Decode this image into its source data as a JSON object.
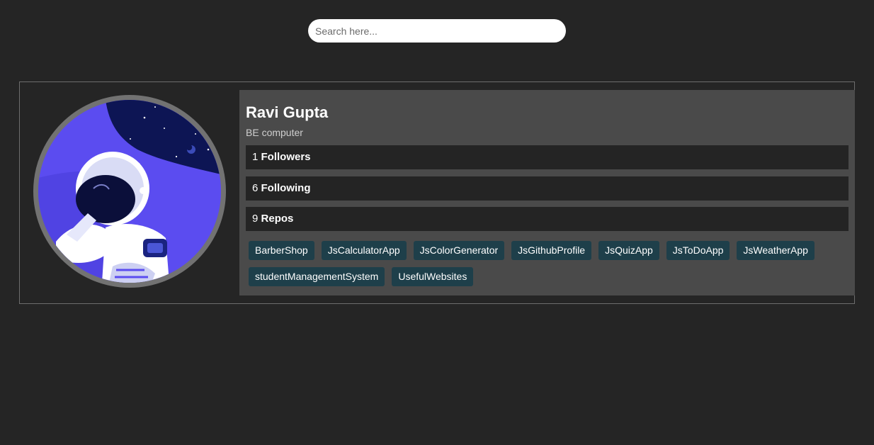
{
  "search": {
    "placeholder": "Search here..."
  },
  "profile": {
    "name": "Ravi Gupta",
    "bio": "BE computer",
    "avatar_icon": "astronaut-avatar",
    "stats": {
      "followers": {
        "count": "1",
        "label": "Followers"
      },
      "following": {
        "count": "6",
        "label": "Following"
      },
      "repos": {
        "count": "9",
        "label": "Repos"
      }
    },
    "repos": [
      "BarberShop",
      "JsCalculatorApp",
      "JsColorGenerator",
      "JsGithubProfile",
      "JsQuizApp",
      "JsToDoApp",
      "JsWeatherApp",
      "studentManagementSystem",
      "UsefulWebsites"
    ]
  },
  "colors": {
    "background": "#252525",
    "info_panel": "#4a4a4a",
    "stat_bar": "#242424",
    "repo_chip": "#1e3f4a",
    "avatar_bg": "#5b4cf0"
  }
}
